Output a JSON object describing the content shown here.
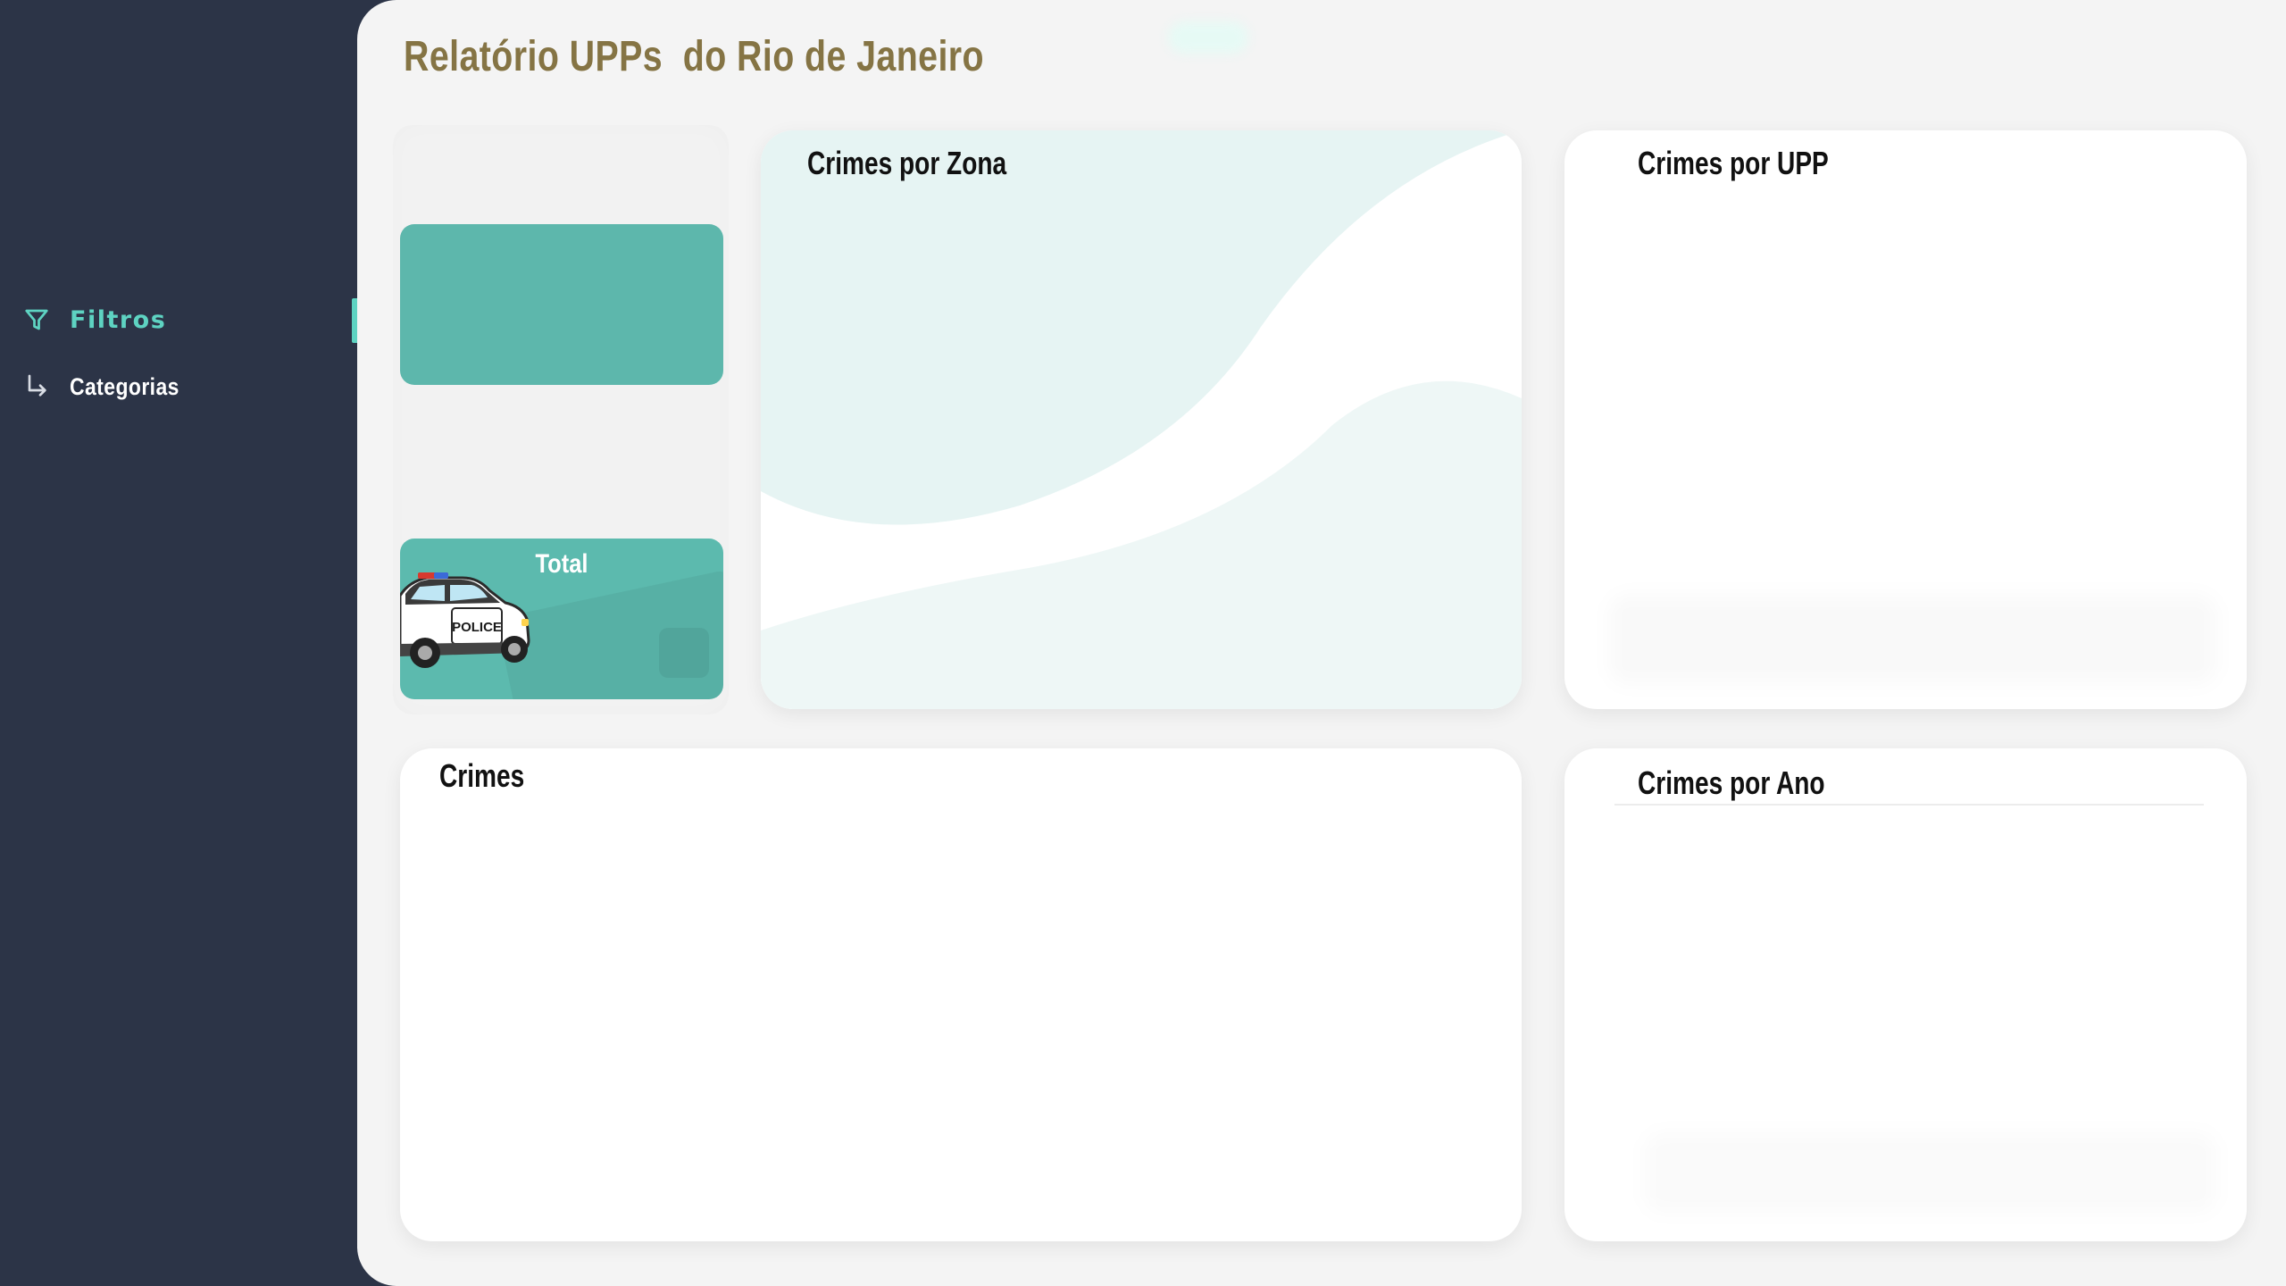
{
  "page": {
    "title": "Relatório UPPs  do Rio de Janeiro"
  },
  "sidebar": {
    "items": [
      {
        "label": "Filtros",
        "icon": "filter-icon",
        "active": true
      },
      {
        "label": "Categorias",
        "icon": "arrow-down-right-icon",
        "active": false
      }
    ]
  },
  "kpis": {
    "total_label": "Total",
    "police_car_text": "POLICE"
  },
  "cards": {
    "zona": "Crimes por Zona",
    "upp": "Crimes por UPP",
    "crimes": "Crimes",
    "ano": "Crimes por Ano"
  },
  "colors": {
    "sidebar_bg": "#2c3447",
    "accent": "#5ed3c2",
    "title": "#857444",
    "kpi_tile": "#5db7ac",
    "main_bg": "#f4f4f4"
  }
}
